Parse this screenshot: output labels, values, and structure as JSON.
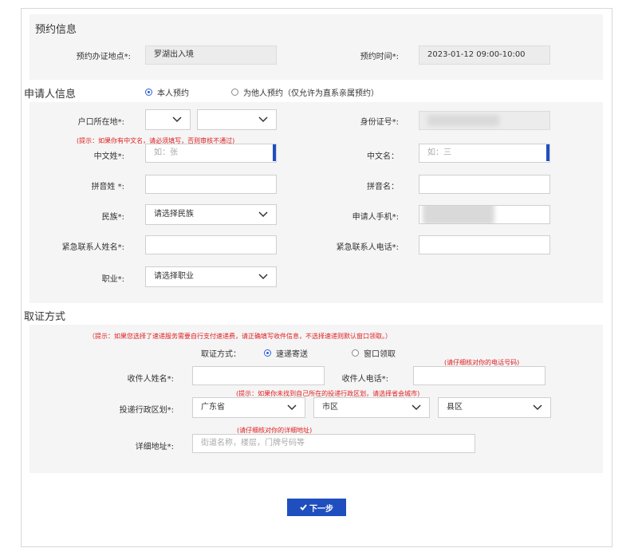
{
  "appointment": {
    "title": "预约信息",
    "location_label": "预约办证地点*:",
    "location_value": "罗湖出入境",
    "time_label": "预约时间*:",
    "time_value": "2023-01-12 09:00-10:00"
  },
  "applicant": {
    "title": "申请人信息",
    "radio_self": "本人预约",
    "radio_other": "为他人预约（仅允许为直系亲属预约）",
    "hukou_label": "户口所在地*:",
    "id_label": "身份证号*:",
    "hint": "(提示：如果你有中文名，请必须填写，否则审核不通过)",
    "cn_surname_label": "中文姓*:",
    "cn_surname_placeholder": "如：张",
    "cn_name_label": "中文名：",
    "cn_name_placeholder": "如：三",
    "py_surname_label": "拼音姓 *:",
    "py_name_label": "拼音名：",
    "ethnic_label": "民族*:",
    "ethnic_value": "请选择民族",
    "phone_label": "申请人手机*:",
    "emergency_name_label": "紧急联系人姓名*:",
    "emergency_phone_label": "紧急联系人电话*:",
    "job_label": "职业*:",
    "job_value": "请选择职业"
  },
  "pickup": {
    "title": "取证方式",
    "hint": "（提示：如果您选择了速递服务需要自行支付速递费，请正确填写收件信息，不选择速递则默认窗口领取。）",
    "method_label": "取证方式：",
    "radio_express": "速递寄送",
    "radio_window": "窗口领取",
    "phone_hint": "(请仔细核对你的电话号码)",
    "recipient_name_label": "收件人姓名*:",
    "recipient_phone_label": "收件人电话*:",
    "district_hint": "(提示：如果你未找到自己所在的投递行政区划，请选择省会城市)",
    "district_label": "投递行政区划*:",
    "province_value": "广东省",
    "city_value": "市区",
    "county_value": "县区",
    "address_hint": "(请仔细核对你的详细地址)",
    "address_label": "详细地址*:",
    "address_placeholder": "街道名称，楼层，门牌号码等"
  },
  "next_button": "下一步",
  "colors": {
    "accent": "#1f4fbf",
    "hint": "#e02020",
    "panel": "#f5f5f6"
  }
}
